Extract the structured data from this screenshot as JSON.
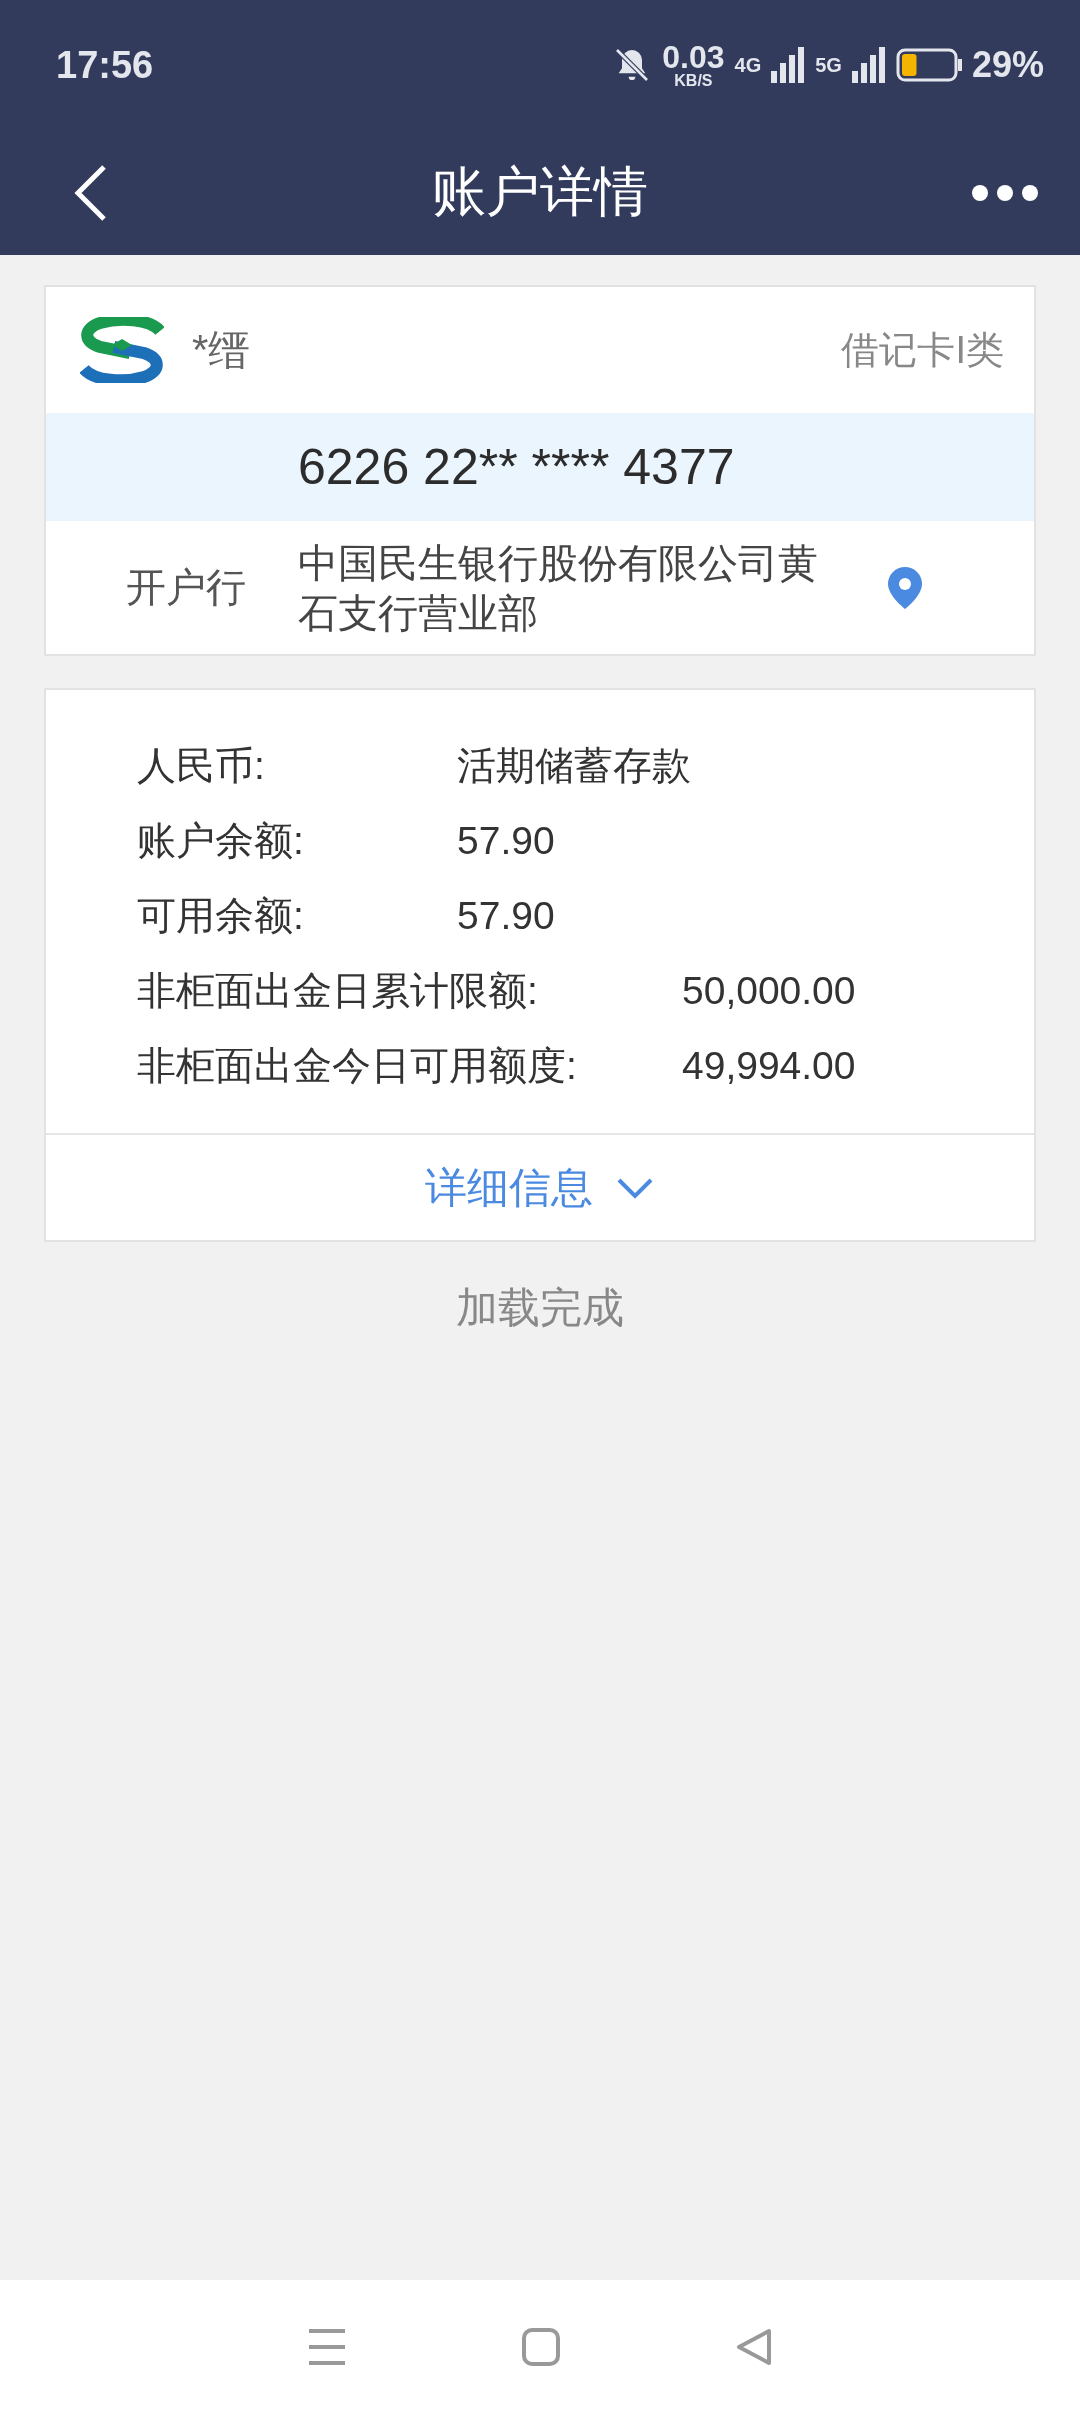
{
  "status_bar": {
    "time": "17:56",
    "net_speed": "0.03",
    "net_unit": "KB/S",
    "network_1": "4G",
    "network_2": "5G",
    "battery": {
      "text": "29%",
      "level": 0.29
    }
  },
  "nav": {
    "title": "账户详情"
  },
  "account": {
    "name": "*缙",
    "card_type": "借记卡I类",
    "card_number": "6226 22** **** 4377",
    "bank_label": "开户行",
    "bank_name": "中国民生银行股份有限公司黄石支行营业部"
  },
  "details": [
    {
      "label": "人民币:",
      "value": "活期储蓄存款"
    },
    {
      "label": "账户余额:",
      "value": "57.90"
    },
    {
      "label": "可用余额:",
      "value": "57.90"
    },
    {
      "label": "非柜面出金日累计限额:",
      "value": "50,000.00"
    },
    {
      "label": "非柜面出金今日可用额度:",
      "value": "49,994.00"
    }
  ],
  "more_button": {
    "label": "详细信息",
    "expanded": false
  },
  "load_status": "加载完成"
}
